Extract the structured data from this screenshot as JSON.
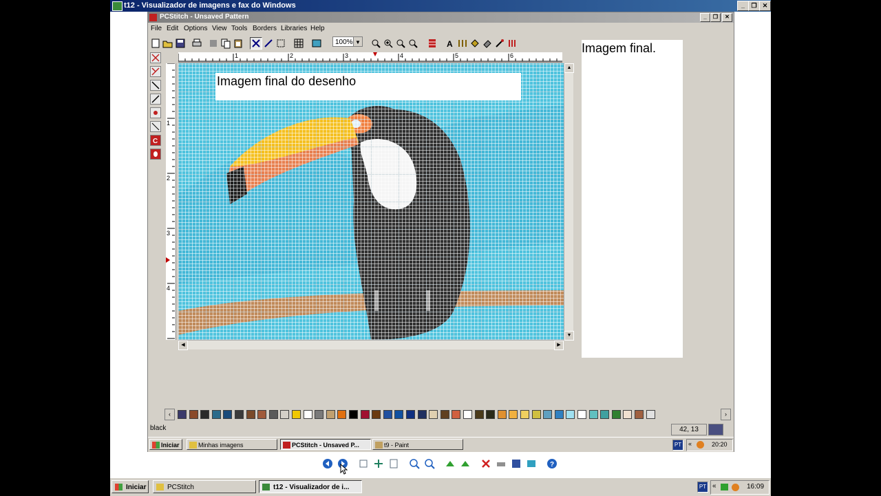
{
  "viewer": {
    "title": "t12 - Visualizador de imagens e fax do Windows",
    "min_label": "_",
    "max_label": "❐",
    "close_label": "✕"
  },
  "pcstitch": {
    "title": "PCStitch - Unsaved Pattern",
    "menu": [
      "File",
      "Edit",
      "Options",
      "View",
      "Tools",
      "Borders",
      "Libraries",
      "Help"
    ],
    "zoom": "100%",
    "ruler_top": [
      "1",
      "2",
      "3",
      "4",
      "5",
      "6"
    ],
    "ruler_left": [
      "1",
      "2",
      "3",
      "4"
    ],
    "caption": "Imagem final do desenho",
    "status_color_name": "black",
    "coords": "42, 13",
    "status_swatch_color": "#4a4f80",
    "min_label": "_",
    "max_label": "❐",
    "close_label": "✕"
  },
  "right_panel": {
    "text": "Imagem final."
  },
  "palette_colors": [
    "#3a3a6a",
    "#8a4a2a",
    "#2a2a2a",
    "#2a6a8a",
    "#1a4a7a",
    "#3a3a3a",
    "#7a4a2a",
    "#a05a3a",
    "#5a5a5a",
    "#d4d0c8",
    "#f0c800",
    "#ffffff",
    "#7a7a7a",
    "#c0a070",
    "#e07010",
    "#000000",
    "#a01030",
    "#6a3a10",
    "#2050a0",
    "#1050a0",
    "#103080",
    "#203060",
    "#e0d0b0",
    "#604020",
    "#d06040",
    "#ffffff",
    "#4a3a1a",
    "#2a2a1a",
    "#e09030",
    "#f0b040",
    "#f0d060",
    "#d0c040",
    "#60a0c0",
    "#3080c0",
    "#a0e0f0",
    "#ffffff",
    "#60c0c0",
    "#40a0a0",
    "#308030",
    "#f0e0d0",
    "#a06040",
    "#e0e0e0"
  ],
  "inner_taskbar": {
    "start": "Iniciar",
    "tasks": [
      "Minhas imagens",
      "PCStitch - Unsaved P...",
      "t9 - Paint"
    ],
    "lang": "PT",
    "time": "20:20"
  },
  "outer_taskbar": {
    "start": "Iniciar",
    "tasks": [
      "PCStitch",
      "t12 - Visualizador de i..."
    ],
    "lang": "PT",
    "time": "16:09"
  }
}
